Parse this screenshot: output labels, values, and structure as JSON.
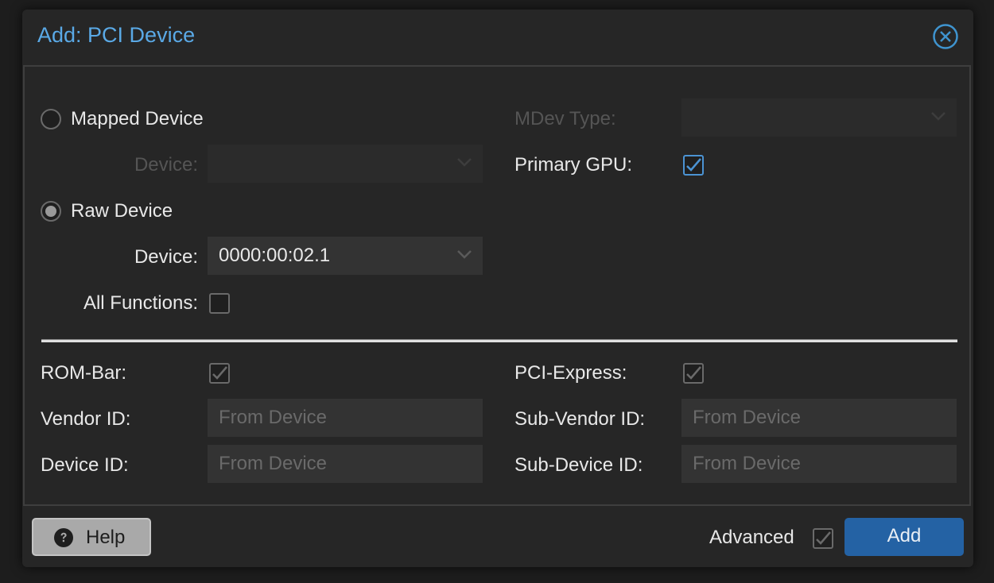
{
  "dialog": {
    "title": "Add: PCI Device",
    "accent_color": "#5aa9e6"
  },
  "left": {
    "mapped_device": {
      "label": "Mapped Device",
      "checked": false
    },
    "mapped_device_select": {
      "label": "Device:",
      "value": "",
      "disabled": true
    },
    "raw_device": {
      "label": "Raw Device",
      "checked": true
    },
    "raw_device_select": {
      "label": "Device:",
      "value": "0000:00:02.1"
    },
    "all_functions": {
      "label": "All Functions:",
      "checked": false
    }
  },
  "right": {
    "mdev_type": {
      "label": "MDev Type:",
      "value": "",
      "disabled": true
    },
    "primary_gpu": {
      "label": "Primary GPU:",
      "checked": true
    }
  },
  "advanced": {
    "rom_bar": {
      "label": "ROM-Bar:",
      "checked": true
    },
    "pci_express": {
      "label": "PCI-Express:",
      "checked": true
    },
    "vendor_id": {
      "label": "Vendor ID:",
      "placeholder": "From Device"
    },
    "device_id": {
      "label": "Device ID:",
      "placeholder": "From Device"
    },
    "sub_vendor_id": {
      "label": "Sub-Vendor ID:",
      "placeholder": "From Device"
    },
    "sub_device_id": {
      "label": "Sub-Device ID:",
      "placeholder": "From Device"
    }
  },
  "footer": {
    "help_label": "Help",
    "advanced_label": "Advanced",
    "advanced_checked": true,
    "add_label": "Add",
    "add_color": "#2462a4"
  }
}
